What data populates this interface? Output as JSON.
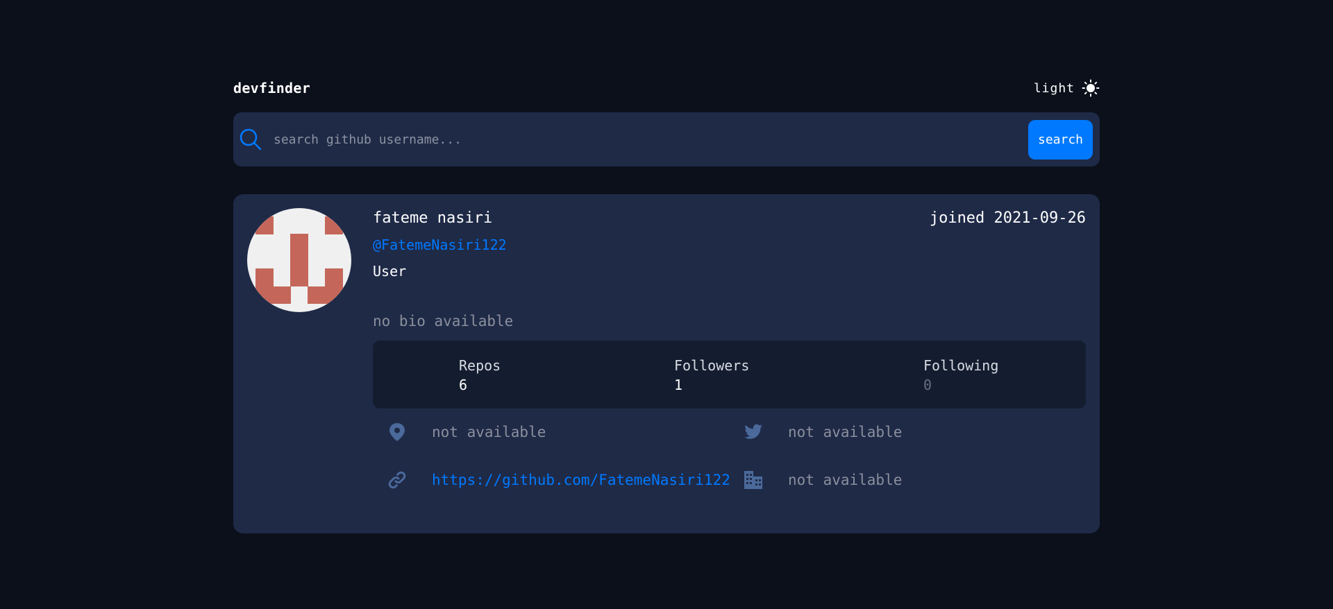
{
  "header": {
    "logo": "devfinder",
    "theme_label": "light"
  },
  "search": {
    "placeholder": "search github username...",
    "button_label": "search"
  },
  "profile": {
    "name": "fateme nasiri",
    "joined": "joined 2021-09-26",
    "login": "@FatemeNasiri122",
    "type": "User",
    "bio": "no bio available"
  },
  "stats": [
    {
      "label": "Repos",
      "value": "6"
    },
    {
      "label": "Followers",
      "value": "1"
    },
    {
      "label": "Following",
      "value": "0"
    }
  ],
  "links": {
    "location": "not available",
    "twitter": "not available",
    "blog": "https://github.com/FatemeNasiri122",
    "company": "not available"
  },
  "icons": {
    "theme": "sun-icon",
    "search": "search-icon",
    "location": "location-pin-icon",
    "twitter": "twitter-icon",
    "blog": "link-icon",
    "company": "building-icon"
  },
  "colors": {
    "background": "#0b101b",
    "card": "#1f2a47",
    "stats_panel": "#141d2f",
    "accent": "#0079ff",
    "muted_text": "#8a8f9c",
    "icon_blue": "#4b6a9b",
    "avatar_red": "#c4675a",
    "avatar_bg": "#f0f0f0"
  }
}
